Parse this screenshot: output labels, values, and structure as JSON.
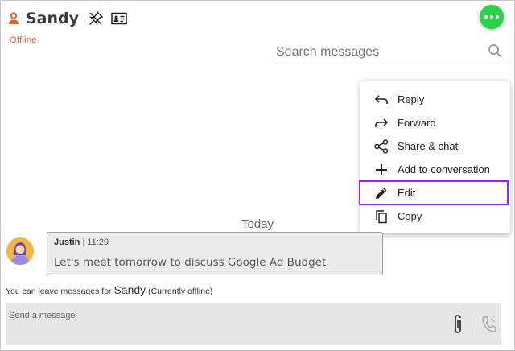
{
  "header": {
    "contact_name": "Sandy",
    "status": "Offline",
    "icons": [
      "user-icon",
      "unpin-icon",
      "contact-card-icon",
      "presence-menu-icon"
    ]
  },
  "search": {
    "placeholder": "Search messages"
  },
  "context_menu": {
    "items": [
      {
        "label": "Reply",
        "icon": "reply-icon"
      },
      {
        "label": "Forward",
        "icon": "forward-icon"
      },
      {
        "label": "Share & chat",
        "icon": "share-icon"
      },
      {
        "label": "Add to conversation",
        "icon": "plus-icon"
      },
      {
        "label": "Edit",
        "icon": "pencil-icon"
      },
      {
        "label": "Copy",
        "icon": "copy-icon"
      }
    ],
    "highlighted": "Edit"
  },
  "conversation": {
    "date_divider": "Today",
    "messages": [
      {
        "sender": "Justin",
        "time": "11:29",
        "text": "Let's meet tomorrow to discuss Google Ad Budget."
      }
    ],
    "offline_note": {
      "prefix": "You can leave messages for",
      "name": "Sandy",
      "suffix": "(Currently offline)"
    }
  },
  "composer": {
    "placeholder": "Send a message"
  },
  "colors": {
    "accent_orange": "#e8602c",
    "presence_green": "#2bd14a",
    "highlight_purple": "#8a2be2"
  }
}
